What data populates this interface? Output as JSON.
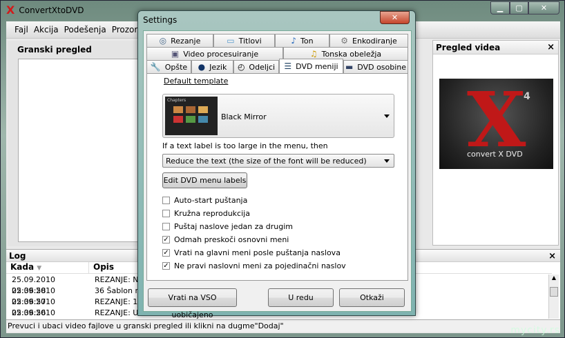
{
  "app": {
    "title": "ConvertXtoDVD",
    "menu": [
      "Fajl",
      "Akcija",
      "Podešenja",
      "Prozor"
    ]
  },
  "left_panel": {
    "title": "Granski pregled"
  },
  "right_panel": {
    "title": "Pregled videa",
    "close": "×",
    "logo_text": "convert X DVD",
    "logo_version": "4"
  },
  "log": {
    "title": "Log",
    "columns": [
      "Kada",
      "Opis"
    ],
    "rows": [
      {
        "time": "25.09.2010 02:36:58",
        "desc": "REZANJE:  N"
      },
      {
        "time": "25.09.2010 02:36:57",
        "desc": "36 Šablon me"
      },
      {
        "time": "25.09.2010 02:36:56",
        "desc": "REZANJE: 1"
      },
      {
        "time": "25.09.2010 02:36:56",
        "desc": "REZANJE: Uč"
      }
    ]
  },
  "status": "Prevuci i ubaci video fajlove u granski pregled ili klikni na dugme\"Dodaj\"",
  "watermark": "mycity.rs",
  "dialog": {
    "title": "Settings",
    "close": "✕",
    "tabs_row1": [
      "Rezanje",
      "Titlovi",
      "Ton",
      "Enkodiranje"
    ],
    "tabs_row2": [
      "Video procesuiranje",
      "Tonska obeležja"
    ],
    "tabs_row3": [
      "Opšte",
      "Jezik",
      "Odeljci",
      "DVD meniji",
      "DVD osobine"
    ],
    "default_template_label": "Default template",
    "template_value": "Black Mirror",
    "thumb_title": "Chapters",
    "text_label_rule": "If a text label is too large in the menu, then",
    "text_label_option": "Reduce the text (the size of the font will be reduced)",
    "edit_labels_button": "Edit DVD menu labels",
    "checkboxes": [
      {
        "label": "Auto-start puštanja",
        "checked": false
      },
      {
        "label": "Kružna reprodukcija",
        "checked": false
      },
      {
        "label": "Puštaj naslove jedan za drugim",
        "checked": false
      },
      {
        "label": "Odmah preskoči osnovni meni",
        "checked": true
      },
      {
        "label": "Vrati na glavni meni posle puštanja naslova",
        "checked": true
      },
      {
        "label": "Ne pravi naslovni meni za pojedinačni naslov",
        "checked": true
      }
    ],
    "reset_button": "Vrati na VSO uobičajeno",
    "ok_button": "U redu",
    "cancel_button": "Otkaži"
  }
}
